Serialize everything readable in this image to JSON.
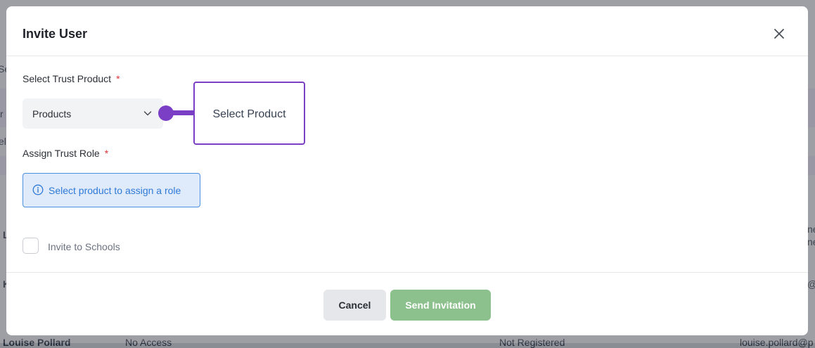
{
  "background": {
    "fragments": [
      "Se",
      "r",
      "el",
      "L",
      "K",
      "Louise Pollard",
      "No Access",
      "Not Registered",
      "louise.pollard@p",
      "ne",
      "ne",
      "@"
    ]
  },
  "modal": {
    "title": "Invite User",
    "close_icon": "close-icon"
  },
  "product_field": {
    "label": "Select Trust Product",
    "required_mark": "*",
    "selected_value": "Products",
    "chevron_icon": "chevron-down-icon"
  },
  "callout": {
    "text": "Select Product",
    "color": "#7a3fc4"
  },
  "role_field": {
    "label": "Assign Trust Role",
    "required_mark": "*",
    "info_icon": "info-icon",
    "info_text": "Select product to assign a role"
  },
  "schools": {
    "label": "Invite to Schools",
    "checked": false
  },
  "footer": {
    "cancel_label": "Cancel",
    "send_label": "Send Invitation",
    "send_color": "#8cc18e"
  }
}
